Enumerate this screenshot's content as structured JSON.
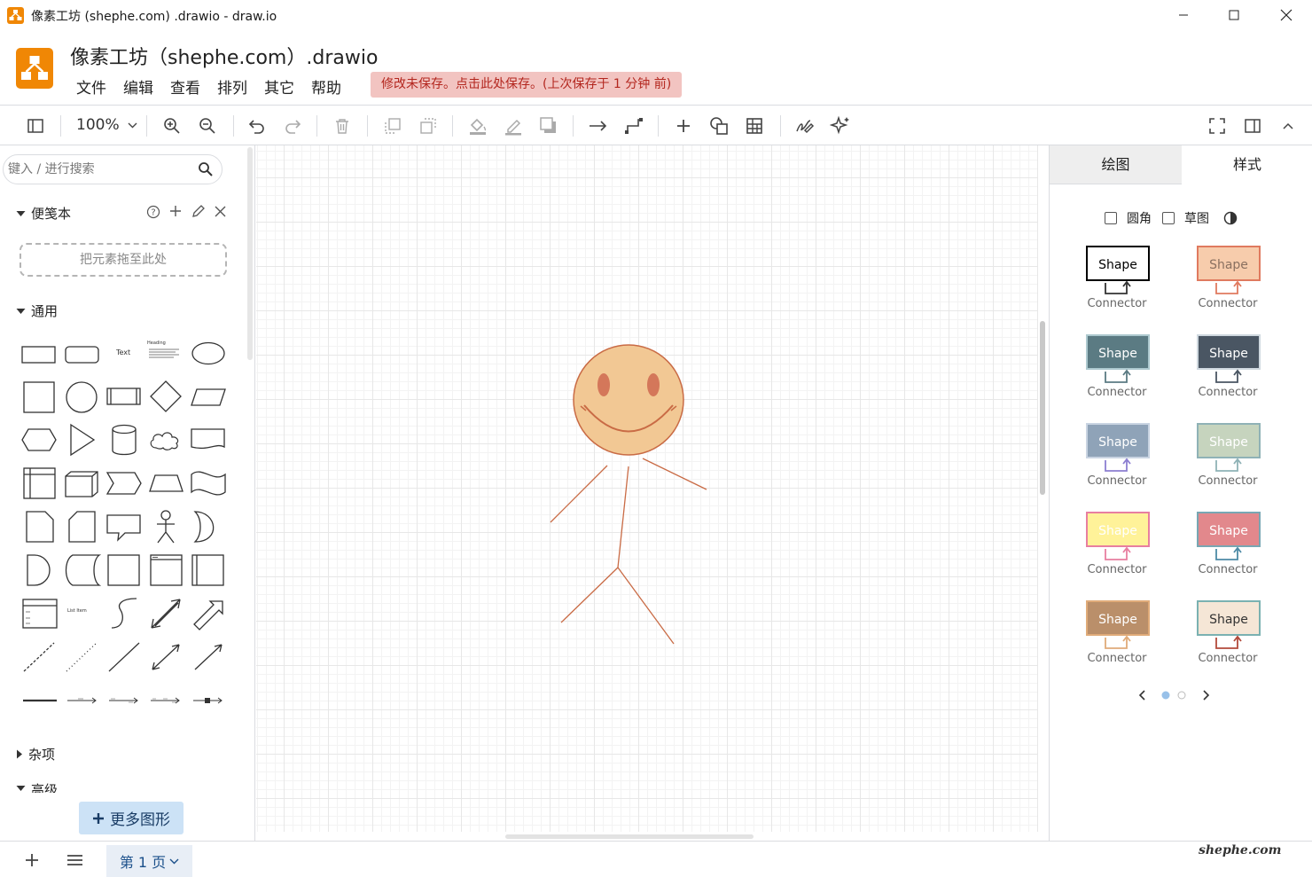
{
  "window": {
    "title": "像素工坊 (shephe.com) .drawio - draw.io"
  },
  "header": {
    "doc_title": "像素工坊（shephe.com）.drawio",
    "menus": [
      "文件",
      "编辑",
      "查看",
      "排列",
      "其它",
      "帮助"
    ],
    "save_notice": "修改未保存。点击此处保存。(上次保存于 1 分钟 前)"
  },
  "toolbar": {
    "zoom": "100%"
  },
  "left_panel": {
    "search_placeholder": "键入 / 进行搜索",
    "scratchpad_label": "便笺本",
    "scratchpad_drop": "把元素拖至此处",
    "general_label": "通用",
    "misc_label": "杂项",
    "advanced_label": "高级",
    "more_shapes": "更多图形",
    "shape_text_label": "Text",
    "shape_heading_label": "Heading",
    "shape_listitem_label": "List Item"
  },
  "right_panel": {
    "tabs": [
      "绘图",
      "样式"
    ],
    "options": {
      "rounded": "圆角",
      "sketch": "草图"
    },
    "styles": [
      {
        "shape": "Shape",
        "connector": "Connector",
        "fill": "#ffffff",
        "stroke": "#000000",
        "text": "#000000",
        "line": "#333333"
      },
      {
        "shape": "Shape",
        "connector": "Connector",
        "fill": "#f7ccac",
        "stroke": "#e07a5f",
        "text": "#8a7060",
        "line": "#e07a5f"
      },
      {
        "shape": "Shape",
        "connector": "Connector",
        "fill": "#5b7b83",
        "stroke": "#adc9cf",
        "text": "#ffffff",
        "line": "#5b7b83"
      },
      {
        "shape": "Shape",
        "connector": "Connector",
        "fill": "#4a5663",
        "stroke": "#cfd8df",
        "text": "#ffffff",
        "line": "#4a5663"
      },
      {
        "shape": "Shape",
        "connector": "Connector",
        "fill": "#8fa3b8",
        "stroke": "#c9d4e2",
        "text": "#ffffff",
        "line": "#8c7fd1"
      },
      {
        "shape": "Shape",
        "connector": "Connector",
        "fill": "#c6d4be",
        "stroke": "#8fb2b6",
        "text": "#ffffff",
        "line": "#8fb2b6"
      },
      {
        "shape": "Shape",
        "connector": "Connector",
        "fill": "#fff299",
        "stroke": "#e87fa0",
        "text": "#ffffff",
        "line": "#e87fa0"
      },
      {
        "shape": "Shape",
        "connector": "Connector",
        "fill": "#e2888c",
        "stroke": "#78a7b3",
        "text": "#ffffff",
        "line": "#4d8aa6"
      },
      {
        "shape": "Shape",
        "connector": "Connector",
        "fill": "#ba8f6a",
        "stroke": "#e0ab79",
        "text": "#ffffff",
        "line": "#e0ab79"
      },
      {
        "shape": "Shape",
        "connector": "Connector",
        "fill": "#f5e6d6",
        "stroke": "#7ab1b1",
        "text": "#333333",
        "line": "#b24a3b"
      }
    ]
  },
  "bottom": {
    "page_tab": "第 1 页",
    "watermark": "shephe.com"
  },
  "canvas": {
    "drawing": "stick-figure-smiley",
    "face_fill": "#f2c894",
    "stroke": "#c96b45"
  },
  "colors": {
    "accent": "#f08705",
    "notice_bg": "#f2c4c1",
    "notice_text": "#b3261e"
  }
}
